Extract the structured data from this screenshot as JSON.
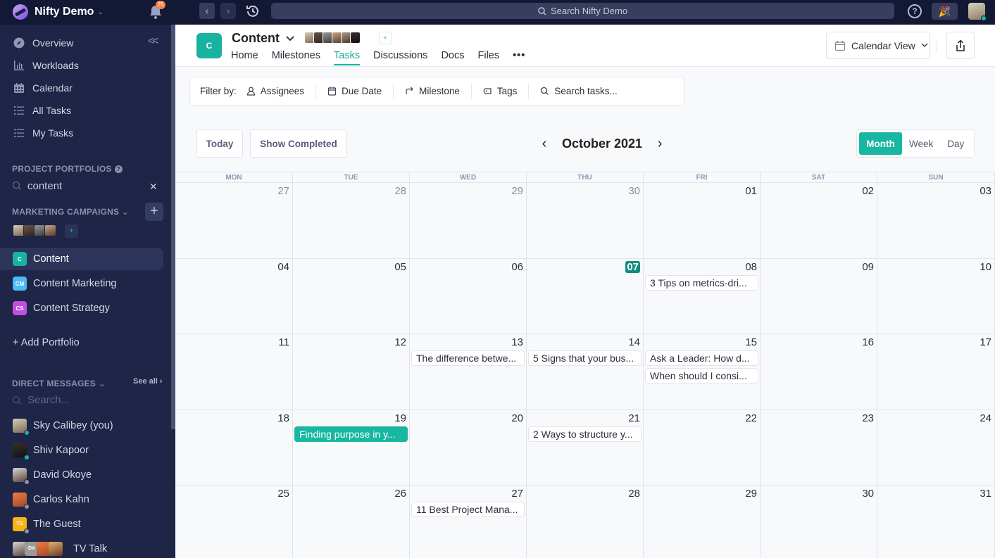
{
  "topbar": {
    "workspace": "Nifty Demo",
    "notification_count": "25",
    "search_placeholder": "Search Nifty Demo"
  },
  "sidebar": {
    "nav": [
      {
        "label": "Overview",
        "icon": "compass-icon"
      },
      {
        "label": "Workloads",
        "icon": "bar-chart-icon"
      },
      {
        "label": "Calendar",
        "icon": "calendar-icon"
      },
      {
        "label": "All Tasks",
        "icon": "list-icon"
      },
      {
        "label": "My Tasks",
        "icon": "checklist-icon"
      }
    ],
    "portfolios_label": "PROJECT PORTFOLIOS",
    "portfolio_search_value": "content",
    "campaign_label": "MARKETING CAMPAIGNS",
    "projects": [
      {
        "label": "Content",
        "badge": "C",
        "color": "#18b3a0",
        "active": true
      },
      {
        "label": "Content Marketing",
        "badge": "CM",
        "color": "#4cb8f5",
        "active": false
      },
      {
        "label": "Content Strategy",
        "badge": "CS",
        "color": "#c34fe0",
        "active": false
      }
    ],
    "add_portfolio": "+ Add Portfolio",
    "dm_label": "DIRECT MESSAGES",
    "see_all": "See all",
    "dm_search_placeholder": "Search...",
    "dms": [
      {
        "name": "Sky Calibey (you)",
        "status": "online"
      },
      {
        "name": "Shiv Kapoor",
        "status": "online"
      },
      {
        "name": "David Okoye",
        "status": "away"
      },
      {
        "name": "Carlos Kahn",
        "status": "away"
      },
      {
        "name": "The Guest",
        "status": "away",
        "initials": "TG"
      },
      {
        "name": "TV Talk",
        "status": "group",
        "initials": "DA"
      }
    ]
  },
  "header": {
    "project_badge": "C",
    "project_title": "Content",
    "tabs": [
      "Home",
      "Milestones",
      "Tasks",
      "Discussions",
      "Docs",
      "Files"
    ],
    "active_tab": "Tasks",
    "more": "•••",
    "view_label": "Calendar View"
  },
  "filters": {
    "label": "Filter by:",
    "items": [
      "Assignees",
      "Due Date",
      "Milestone",
      "Tags"
    ],
    "search_placeholder": "Search tasks..."
  },
  "calendar": {
    "today_btn": "Today",
    "show_completed_btn": "Show Completed",
    "month_label": "October 2021",
    "views": [
      "Month",
      "Week",
      "Day"
    ],
    "active_view": "Month",
    "weekdays": [
      "MON",
      "TUE",
      "WED",
      "THU",
      "FRI",
      "SAT",
      "SUN"
    ],
    "weeks": [
      [
        {
          "d": "27",
          "muted": true
        },
        {
          "d": "28",
          "muted": true
        },
        {
          "d": "29",
          "muted": true
        },
        {
          "d": "30",
          "muted": true
        },
        {
          "d": "01"
        },
        {
          "d": "02"
        },
        {
          "d": "03"
        }
      ],
      [
        {
          "d": "04"
        },
        {
          "d": "05"
        },
        {
          "d": "06"
        },
        {
          "d": "07",
          "today": true
        },
        {
          "d": "08",
          "tasks": [
            "3 Tips on metrics-dri..."
          ]
        },
        {
          "d": "09"
        },
        {
          "d": "10"
        }
      ],
      [
        {
          "d": "11"
        },
        {
          "d": "12"
        },
        {
          "d": "13",
          "tasks": [
            "The difference betwe..."
          ]
        },
        {
          "d": "14",
          "tasks": [
            "5 Signs that your bus..."
          ]
        },
        {
          "d": "15",
          "tasks": [
            "Ask a Leader: How d...",
            "When should I consi..."
          ]
        },
        {
          "d": "16"
        },
        {
          "d": "17"
        }
      ],
      [
        {
          "d": "18"
        },
        {
          "d": "19",
          "tasks": [
            "Finding purpose in y..."
          ],
          "highlight": true
        },
        {
          "d": "20"
        },
        {
          "d": "21",
          "tasks": [
            "2 Ways to structure y..."
          ]
        },
        {
          "d": "22"
        },
        {
          "d": "23"
        },
        {
          "d": "24"
        }
      ],
      [
        {
          "d": "25"
        },
        {
          "d": "26"
        },
        {
          "d": "27",
          "tasks": [
            "11 Best Project Mana..."
          ]
        },
        {
          "d": "28"
        },
        {
          "d": "29"
        },
        {
          "d": "30"
        },
        {
          "d": "31"
        }
      ]
    ]
  }
}
